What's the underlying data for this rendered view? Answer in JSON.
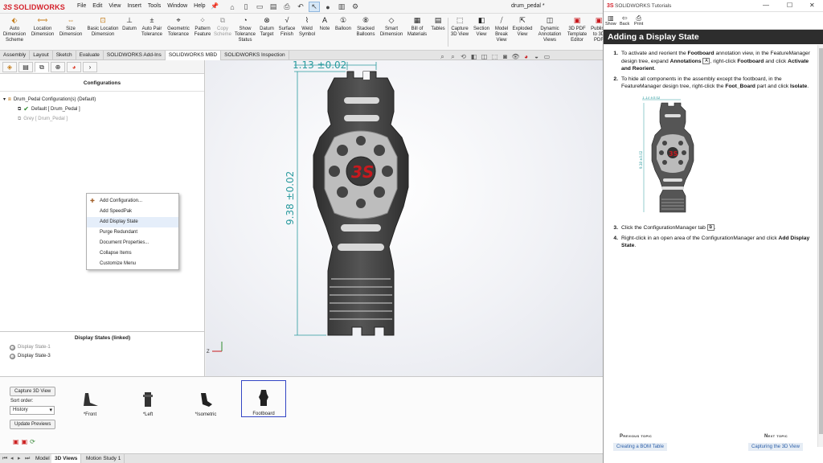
{
  "app": {
    "logo_text": "SOLIDWORKS",
    "document_title": "drum_pedal *"
  },
  "menu": [
    "File",
    "Edit",
    "View",
    "Insert",
    "Tools",
    "Window",
    "Help"
  ],
  "ribbon": [
    {
      "label": "Auto Dimension Scheme",
      "icon": "dimension-scheme-icon"
    },
    {
      "label": "Location Dimension",
      "icon": "location-dimension-icon"
    },
    {
      "label": "Size Dimension",
      "icon": "size-dimension-icon"
    },
    {
      "label": "Basic Location Dimension",
      "icon": "basic-location-icon"
    },
    {
      "label": "Datum",
      "icon": "datum-icon"
    },
    {
      "label": "Auto Pair Tolerance",
      "icon": "pair-tolerance-icon"
    },
    {
      "label": "Geometric Tolerance",
      "icon": "geometric-tolerance-icon"
    },
    {
      "label": "Pattern Feature",
      "icon": "pattern-feature-icon"
    },
    {
      "label": "Copy Scheme",
      "icon": "copy-scheme-icon",
      "disabled": true
    },
    {
      "label": "Show Tolerance Status",
      "icon": "tolerance-status-icon"
    },
    {
      "label": "Datum Target",
      "icon": "datum-target-icon"
    },
    {
      "label": "Surface Finish",
      "icon": "surface-finish-icon"
    },
    {
      "label": "Weld Symbol",
      "icon": "weld-symbol-icon"
    },
    {
      "label": "Note",
      "icon": "note-icon"
    },
    {
      "label": "Balloon",
      "icon": "balloon-icon"
    },
    {
      "label": "Stacked Balloons",
      "icon": "stacked-balloons-icon"
    },
    {
      "label": "Smart Dimension",
      "icon": "smart-dimension-icon"
    },
    {
      "label": "Bill of Materials",
      "icon": "bom-icon"
    },
    {
      "label": "Tables",
      "icon": "tables-icon"
    },
    {
      "label": "Capture 3D View",
      "icon": "capture-3d-view-icon"
    },
    {
      "label": "Section View",
      "icon": "section-view-icon"
    },
    {
      "label": "Model Break View",
      "icon": "model-break-view-icon"
    },
    {
      "label": "Exploded View",
      "icon": "exploded-view-icon"
    },
    {
      "label": "Dynamic Annotation Views",
      "icon": "dynamic-annotation-icon"
    },
    {
      "label": "3D PDF Template Editor",
      "icon": "pdf-template-icon"
    },
    {
      "label": "Publish to 3D PDF",
      "icon": "publish-pdf-icon"
    }
  ],
  "command_tabs": [
    {
      "label": "Assembly"
    },
    {
      "label": "Layout"
    },
    {
      "label": "Sketch"
    },
    {
      "label": "Evaluate"
    },
    {
      "label": "SOLIDWORKS Add-Ins"
    },
    {
      "label": "SOLIDWORKS MBD",
      "active": true
    },
    {
      "label": "SOLIDWORKS Inspection"
    }
  ],
  "config_panel": {
    "title": "Configurations",
    "tree": {
      "root": "Drum_Pedal Configuration(s)  (Default)",
      "items": [
        {
          "label": "Default [ Drum_Pedal ]",
          "active": true
        },
        {
          "label": "Grey [ Drum_Pedal ]",
          "active": false
        }
      ]
    }
  },
  "context_menu": [
    {
      "label": "Add Configuration...",
      "icon": "add-config-icon"
    },
    {
      "label": "Add SpeedPak"
    },
    {
      "label": "Add Display State",
      "highlighted": true
    },
    {
      "label": "Purge Redundant"
    },
    {
      "label": "Document Properties..."
    },
    {
      "label": "Collapse Items"
    },
    {
      "label": "Customize Menu"
    }
  ],
  "display_states": {
    "title": "Display States (linked)",
    "items": [
      "Display State-1",
      "Display State-3"
    ]
  },
  "viewport": {
    "dimension_width": "1.13 ±0.02",
    "dimension_height": "9.38 ±0.02",
    "brand_red": "#c8191e",
    "body_color": "#4a4a4a"
  },
  "bottom_panel": {
    "capture_button": "Capture 3D View",
    "sort_label": "Sort order:",
    "sort_value": "History",
    "update_button": "Update Previews",
    "views": [
      {
        "label": "*Front"
      },
      {
        "label": "*Left"
      },
      {
        "label": "*Isometric"
      },
      {
        "label": "Footboard",
        "selected": true
      }
    ]
  },
  "bottom_tabs": [
    {
      "label": "Model"
    },
    {
      "label": "3D Views",
      "active": true
    },
    {
      "label": "Motion Study 1"
    }
  ],
  "tutorial": {
    "window_title": "SOLIDWORKS Tutorials",
    "toolbar": {
      "show": "Show",
      "back": "Back",
      "print": "Print"
    },
    "heading": "Adding a Display State",
    "steps": {
      "s1_num": "1.",
      "s1_a": "To activate and reorient the ",
      "s1_b": "Footboard",
      "s1_c": " annotation view, in the FeatureManager design tree, expand ",
      "s1_d": "Annotations",
      "s1_e": ", right-click ",
      "s1_f": "Footboard",
      "s1_g": " and click ",
      "s1_h": "Activate and Reorient",
      "s1_i": ".",
      "s2_num": "2.",
      "s2_a": "To hide all components in the assembly except the footboard, in the FeatureManager design tree, right-click the ",
      "s2_b": "Foot_Board",
      "s2_c": " part and click ",
      "s2_d": "Isolate",
      "s2_e": ".",
      "s3_num": "3.",
      "s3_a": "Click the ConfigurationManager tab ",
      "s3_b": ".",
      "s4_num": "4.",
      "s4_a": "Right-click in an open area of the ConfigurationManager and click ",
      "s4_b": "Add Display State",
      "s4_c": "."
    },
    "previous_label": "Previous topic",
    "previous_link": "Creating a BOM Table",
    "next_label": "Next topic",
    "next_link": "Capturing the 3D View"
  }
}
